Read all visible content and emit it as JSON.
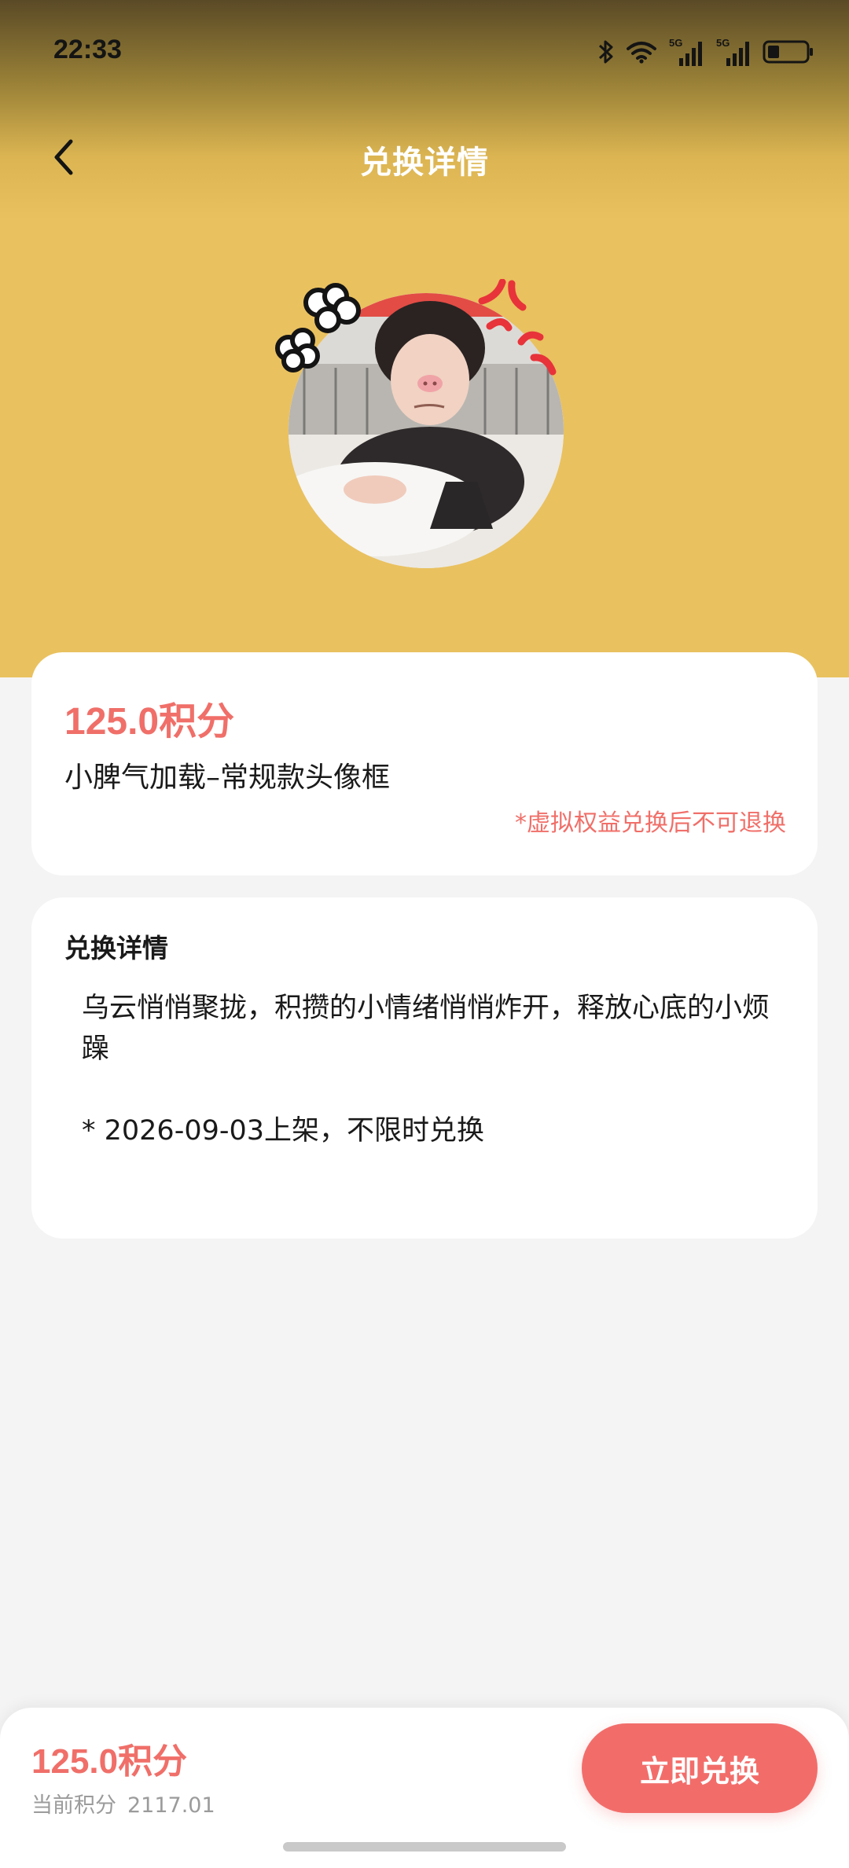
{
  "status_bar": {
    "time": "22:33",
    "network_labels": [
      "5G",
      "5G"
    ],
    "battery_level": 0.3,
    "icons": [
      "bluetooth-icon",
      "wifi-icon",
      "signal-5g-icon",
      "signal-5g-icon",
      "battery-icon"
    ]
  },
  "nav": {
    "title": "兑换详情",
    "back_icon": "chevron-left-icon"
  },
  "product": {
    "price": "125.0积分",
    "name": "小脾气加载–常规款头像框",
    "note": "*虚拟权益兑换后不可退换"
  },
  "details": {
    "heading": "兑换详情",
    "description": "乌云悄悄聚拢，积攒的小情绪悄悄炸开，释放心底的小烦躁",
    "listing": "*  2026-09-03上架，不限时兑换"
  },
  "bottom": {
    "price": "125.0积分",
    "balance_label": "当前积分",
    "balance_value": "2117.01",
    "redeem_label": "立即兑换"
  },
  "colors": {
    "header_yellow": "#e9c15f",
    "accent_coral": "#f06f69",
    "button_coral": "#f26d6a",
    "page_bg": "#f4f4f4"
  }
}
